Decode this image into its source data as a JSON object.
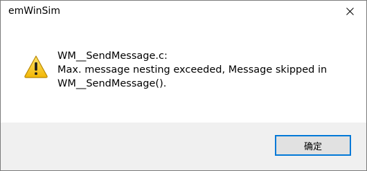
{
  "window": {
    "title": "emWinSim",
    "close_icon": "close-icon"
  },
  "message": {
    "icon": "warning-icon",
    "icon_color": "#f5c518",
    "lines": [
      "WM__SendMessage.c:",
      "Max. message nesting exceeded, Message skipped in",
      "WM__SendMessage()."
    ]
  },
  "buttons": {
    "ok_label": "确定",
    "accent": "#0078d7"
  }
}
